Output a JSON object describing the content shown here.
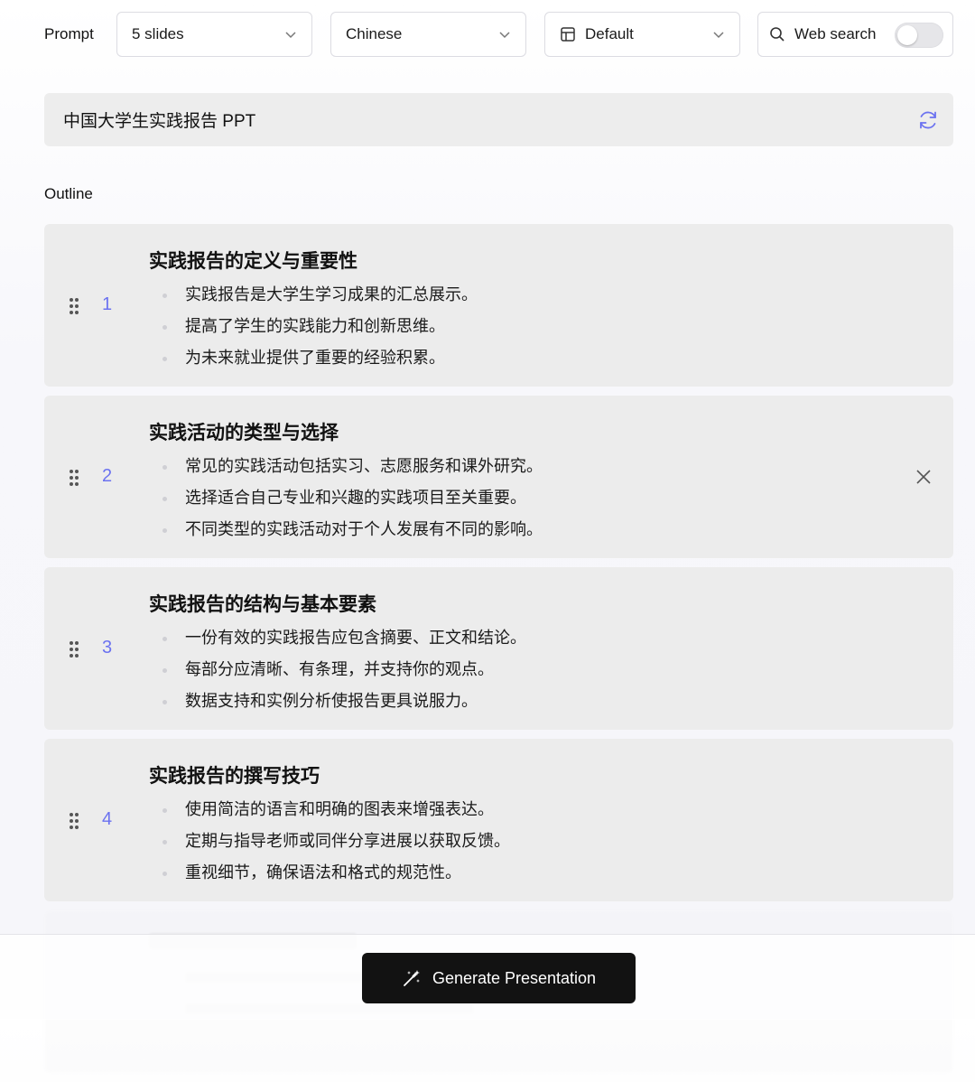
{
  "toolbar": {
    "prompt_label": "Prompt",
    "slides_value": "5 slides",
    "language_value": "Chinese",
    "theme_value": "Default",
    "web_search_label": "Web search",
    "web_search_enabled": false
  },
  "topic": {
    "text": "中国大学生实践报告 PPT"
  },
  "outline": {
    "label": "Outline",
    "items": [
      {
        "num": "1",
        "title": "实践报告的定义与重要性",
        "bullets": [
          "实践报告是大学生学习成果的汇总展示。",
          "提高了学生的实践能力和创新思维。",
          "为未来就业提供了重要的经验积累。"
        ]
      },
      {
        "num": "2",
        "title": "实践活动的类型与选择",
        "bullets": [
          "常见的实践活动包括实习、志愿服务和课外研究。",
          "选择适合自己专业和兴趣的实践项目至关重要。",
          "不同类型的实践活动对于个人发展有不同的影响。"
        ]
      },
      {
        "num": "3",
        "title": "实践报告的结构与基本要素",
        "bullets": [
          "一份有效的实践报告应包含摘要、正文和结论。",
          "每部分应清晰、有条理，并支持你的观点。",
          "数据支持和实例分析使报告更具说服力。"
        ]
      },
      {
        "num": "4",
        "title": "实践报告的撰写技巧",
        "bullets": [
          "使用简洁的语言和明确的图表来增强表达。",
          "定期与指导老师或同伴分享进展以获取反馈。",
          "重视细节，确保语法和格式的规范性。"
        ]
      }
    ]
  },
  "generate_button": {
    "label": "Generate Presentation"
  },
  "colors": {
    "accent_number": "#6b72f0",
    "button_bg": "#121212",
    "card_bg": "#ececec"
  }
}
